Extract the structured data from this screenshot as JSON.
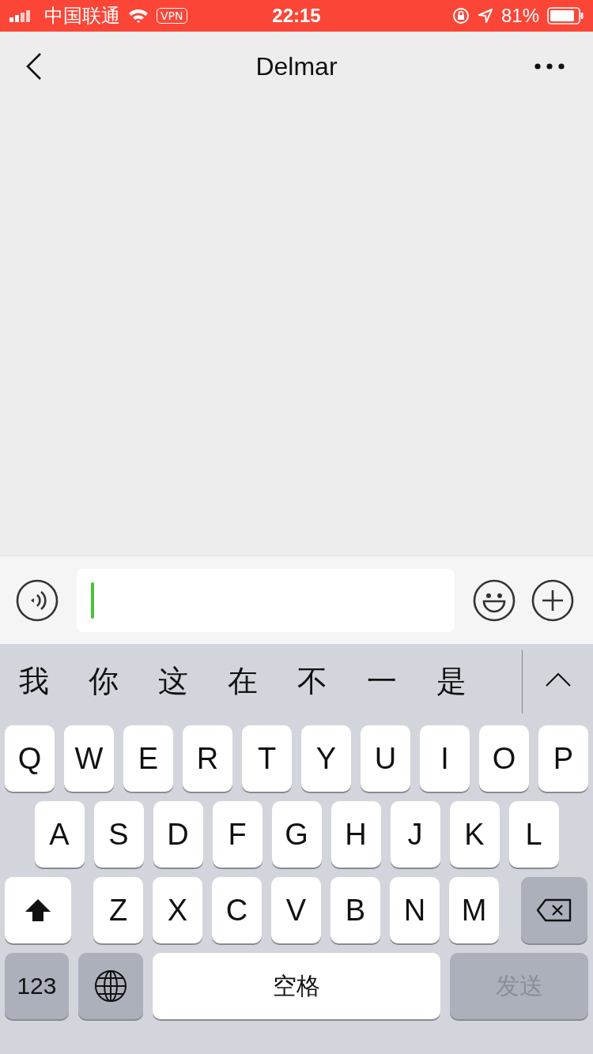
{
  "status_bar": {
    "carrier": "中国联通",
    "vpn": "VPN",
    "time": "22:15",
    "battery": "81%"
  },
  "nav": {
    "title": "Delmar"
  },
  "input_bar": {
    "focused": true
  },
  "keyboard": {
    "candidates": [
      "我",
      "你",
      "这",
      "在",
      "不",
      "一",
      "是"
    ],
    "rows": [
      [
        {
          "kind": "letter",
          "label": "Q"
        },
        {
          "kind": "letter",
          "label": "W"
        },
        {
          "kind": "letter",
          "label": "E"
        },
        {
          "kind": "letter",
          "label": "R"
        },
        {
          "kind": "letter",
          "label": "T"
        },
        {
          "kind": "letter",
          "label": "Y"
        },
        {
          "kind": "letter",
          "label": "U"
        },
        {
          "kind": "letter",
          "label": "I"
        },
        {
          "kind": "letter",
          "label": "O"
        },
        {
          "kind": "letter",
          "label": "P"
        }
      ],
      [
        {
          "kind": "letter",
          "label": "A"
        },
        {
          "kind": "letter",
          "label": "S"
        },
        {
          "kind": "letter",
          "label": "D"
        },
        {
          "kind": "letter",
          "label": "F"
        },
        {
          "kind": "letter",
          "label": "G"
        },
        {
          "kind": "letter",
          "label": "H"
        },
        {
          "kind": "letter",
          "label": "J"
        },
        {
          "kind": "letter",
          "label": "K"
        },
        {
          "kind": "letter",
          "label": "L"
        }
      ],
      [
        {
          "kind": "shift"
        },
        {
          "kind": "letter",
          "label": "Z"
        },
        {
          "kind": "letter",
          "label": "X"
        },
        {
          "kind": "letter",
          "label": "C"
        },
        {
          "kind": "letter",
          "label": "V"
        },
        {
          "kind": "letter",
          "label": "B"
        },
        {
          "kind": "letter",
          "label": "N"
        },
        {
          "kind": "letter",
          "label": "M"
        },
        {
          "kind": "delete"
        }
      ]
    ],
    "bottom_keys": {
      "numbers": "123",
      "space": "空格",
      "send": {
        "label": "发送",
        "disabled": true
      }
    }
  }
}
